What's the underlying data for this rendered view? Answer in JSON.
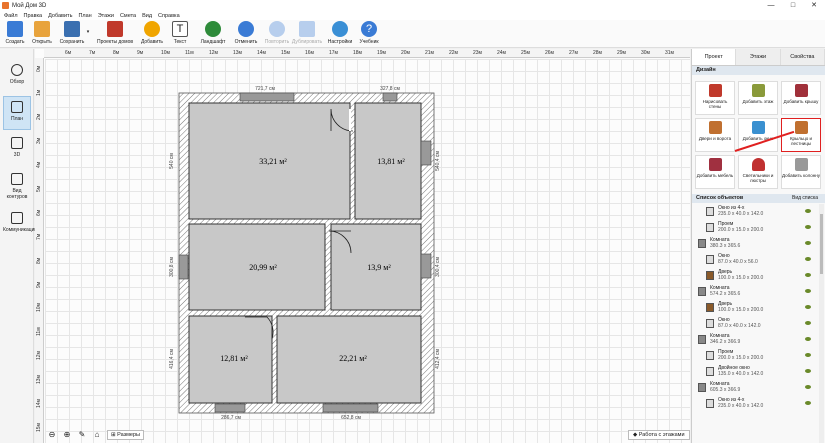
{
  "app": {
    "title": "Мой Дом 3D"
  },
  "menu": [
    "Файл",
    "Правка",
    "Добавить",
    "План",
    "Этажи",
    "Смета",
    "Вид",
    "Справка"
  ],
  "toolbar": {
    "items": [
      {
        "label": "Создать",
        "icon": "new-doc-icon",
        "color": "#3a7bd5"
      },
      {
        "label": "Открыть",
        "icon": "folder-icon",
        "color": "#e8a33c"
      },
      {
        "label": "Сохранить",
        "icon": "save-icon",
        "color": "#3a6fb0"
      },
      {
        "label": "Проекты домов",
        "icon": "house-projects-icon",
        "color": "#c0392b"
      },
      {
        "label": "Добавить",
        "icon": "add-icon",
        "color": "#f0a500"
      },
      {
        "label": "Текст",
        "icon": "text-icon",
        "color": "#555555"
      },
      {
        "label": "Ландшафт",
        "icon": "tree-icon",
        "color": "#2e8b3a"
      },
      {
        "label": "Отменить",
        "icon": "undo-icon",
        "color": "#3a7bd5"
      },
      {
        "label": "Повторить",
        "icon": "redo-icon",
        "color": "#3a7bd5"
      },
      {
        "label": "Дублировать",
        "icon": "duplicate-icon",
        "color": "#3a7bd5"
      },
      {
        "label": "Настройки",
        "icon": "gear-icon",
        "color": "#3a8fd5"
      },
      {
        "label": "Учебник",
        "icon": "help-icon",
        "color": "#3a7bd5"
      }
    ]
  },
  "left_nav": [
    {
      "label": "Обзор",
      "icon": "eye-icon"
    },
    {
      "label": "План",
      "icon": "plan-icon",
      "active": true
    },
    {
      "label": "3D",
      "icon": "cube-icon"
    },
    {
      "label": "Вид контуров",
      "icon": "contour-icon"
    },
    {
      "label": "Коммуникации",
      "icon": "communications-icon"
    }
  ],
  "ruler_top": [
    "6м",
    "7м",
    "8м",
    "9м",
    "10м",
    "11м",
    "12м",
    "13м",
    "14м",
    "15м",
    "16м",
    "17м",
    "18м",
    "19м",
    "20м",
    "21м",
    "22м",
    "23м",
    "24м",
    "25м",
    "26м",
    "27м",
    "28м",
    "29м",
    "30м",
    "31м"
  ],
  "ruler_left": [
    "0м",
    "1м",
    "2м",
    "3м",
    "4м",
    "5м",
    "6м",
    "7м",
    "8м",
    "9м",
    "10м",
    "11м",
    "12м",
    "13м",
    "14м",
    "15м"
  ],
  "plan": {
    "rooms": [
      {
        "area": "33,21 м²"
      },
      {
        "area": "13,81 м²"
      },
      {
        "area": "20,99 м²"
      },
      {
        "area": "13,9 м²"
      },
      {
        "area": "12,81 м²"
      },
      {
        "area": "22,21 м²"
      }
    ],
    "dimensions": [
      "721,7 см",
      "327,8 см",
      "540 см",
      "300,8 см",
      "416,4 см",
      "286,7 см",
      "652,8 см",
      "540,4 см",
      "300,4 см",
      "412,4 см"
    ]
  },
  "bottom": {
    "sizes": "Размеры",
    "work_floors": "Работа с этажами"
  },
  "right_panel": {
    "tabs": [
      "Проект",
      "Этажи",
      "Свойства"
    ],
    "design_title": "Дизайн",
    "design_buttons": [
      {
        "label": "Нарисовать стены",
        "icon": "walls-icon",
        "color": "#c0392b"
      },
      {
        "label": "Добавить этаж",
        "icon": "floor-icon",
        "color": "#8a9a3a"
      },
      {
        "label": "Добавить крышу",
        "icon": "roof-icon",
        "color": "#a0303a"
      },
      {
        "label": "Двери и ворота",
        "icon": "door-icon",
        "color": "#c07030"
      },
      {
        "label": "Добавить окно",
        "icon": "window-icon",
        "color": "#3a90d0"
      },
      {
        "label": "Крыльцо и лестницы",
        "icon": "stairs-icon",
        "color": "#c07030",
        "highlighted": true
      },
      {
        "label": "Добавить мебель",
        "icon": "furniture-icon",
        "color": "#a03040"
      },
      {
        "label": "Светильники и люстры",
        "icon": "lamp-icon",
        "color": "#c03030"
      },
      {
        "label": "Добавить колонну",
        "icon": "column-icon",
        "color": "#999999"
      }
    ],
    "objects_title": "Список объектов",
    "objects_alt": "Вид списка",
    "objects": [
      {
        "name": "Окно из 4-х",
        "size": "235.0 x 40.0 x 142.0",
        "indent": true
      },
      {
        "name": "Проем",
        "size": "200.0 x 15.0 x 200.0",
        "indent": true
      },
      {
        "name": "Комната",
        "size": "380.3 x 365.6",
        "indent": false
      },
      {
        "name": "Окно",
        "size": "87.0 x 40.0 x 56.0",
        "indent": true
      },
      {
        "name": "Дверь",
        "size": "100.0 x 15.0 x 200.0",
        "indent": true
      },
      {
        "name": "Комната",
        "size": "574.2 x 365.6",
        "indent": false
      },
      {
        "name": "Дверь",
        "size": "100.0 x 15.0 x 200.0",
        "indent": true
      },
      {
        "name": "Окно",
        "size": "87.0 x 40.0 x 142.0",
        "indent": true
      },
      {
        "name": "Комната",
        "size": "346.2 x 366.9",
        "indent": false
      },
      {
        "name": "Проем",
        "size": "200.0 x 15.0 x 200.0",
        "indent": true
      },
      {
        "name": "Двойное окно",
        "size": "135.0 x 40.0 x 142.0",
        "indent": true
      },
      {
        "name": "Комната",
        "size": "605.3 x 366.9",
        "indent": false
      },
      {
        "name": "Окно из 4-х",
        "size": "235.0 x 40.0 x 142.0",
        "indent": true
      }
    ]
  }
}
